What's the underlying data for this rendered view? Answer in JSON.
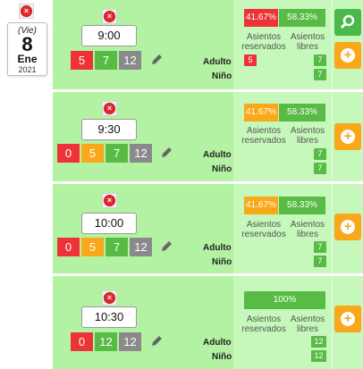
{
  "date": {
    "dow": "(Vie)",
    "day": "8",
    "month": "Ene",
    "year": "2021"
  },
  "labels": {
    "adult": "Adulto",
    "child": "Niño",
    "reserved": "Asientos reservados",
    "free": "Asientos libres"
  },
  "slots": [
    {
      "time": "9:00",
      "counts": [
        "5",
        "7",
        "12"
      ],
      "reserved_pct": "41.67%",
      "free_pct": "58.33%",
      "adult": "5",
      "adult_free": "7",
      "child_free": "7"
    },
    {
      "time": "9:30",
      "counts": [
        "0",
        "5",
        "7",
        "12"
      ],
      "reserved_pct": "41.67%",
      "free_pct": "58.33%",
      "adult_free": "7",
      "child_free": "7"
    },
    {
      "time": "10:00",
      "counts": [
        "0",
        "5",
        "7",
        "12"
      ],
      "reserved_pct": "41.67%",
      "free_pct": "58.33%",
      "adult_free": "7",
      "child_free": "7"
    },
    {
      "time": "10:30",
      "counts": [
        "0",
        "12",
        "12"
      ],
      "full_pct": "100%",
      "adult_free": "12",
      "child_free": "12"
    }
  ],
  "colors": {
    "slot_bg": "#b2f2a2",
    "red": "#ee3338",
    "orange": "#f9a81a",
    "green": "#58bb46",
    "grey": "#8a8a8a"
  },
  "icons": [
    "close-icon",
    "pencil-icon",
    "search-icon",
    "plus-icon"
  ]
}
